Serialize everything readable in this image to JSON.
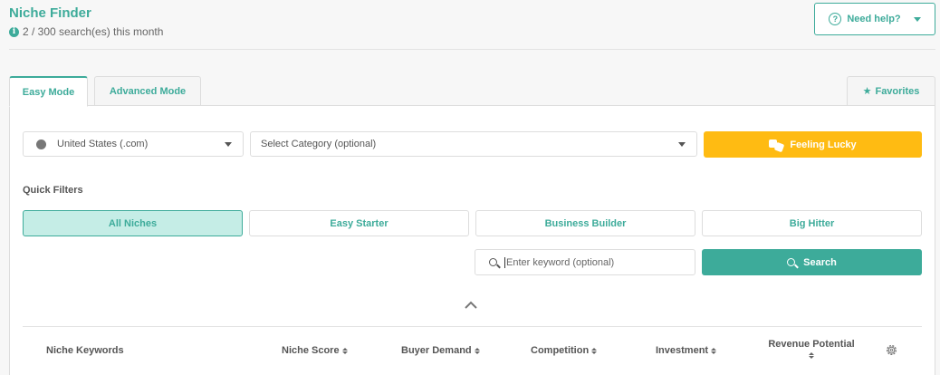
{
  "header": {
    "title": "Niche Finder",
    "usage": "2 / 300 search(es) this month",
    "help_label": "Need help?"
  },
  "tabs": [
    {
      "label": "Easy Mode",
      "active": true
    },
    {
      "label": "Advanced Mode",
      "active": false
    }
  ],
  "favorites_label": "Favorites",
  "controls": {
    "marketplace": "United States (.com)",
    "category_placeholder": "Select Category (optional)",
    "lucky_label": "Feeling Lucky"
  },
  "quick_filters": {
    "label": "Quick Filters",
    "options": [
      {
        "label": "All Niches",
        "active": true
      },
      {
        "label": "Easy Starter",
        "active": false
      },
      {
        "label": "Business Builder",
        "active": false
      },
      {
        "label": "Big Hitter",
        "active": false
      }
    ]
  },
  "search": {
    "placeholder": "Enter keyword (optional)",
    "button_label": "Search"
  },
  "table": {
    "columns": [
      "Niche Keywords",
      "Niche Score",
      "Buyer Demand",
      "Competition",
      "Investment",
      "Revenue Potential"
    ]
  },
  "colors": {
    "accent": "#3dab9a",
    "lucky": "#ffbb12",
    "active_filter_bg": "#c5ede6"
  }
}
